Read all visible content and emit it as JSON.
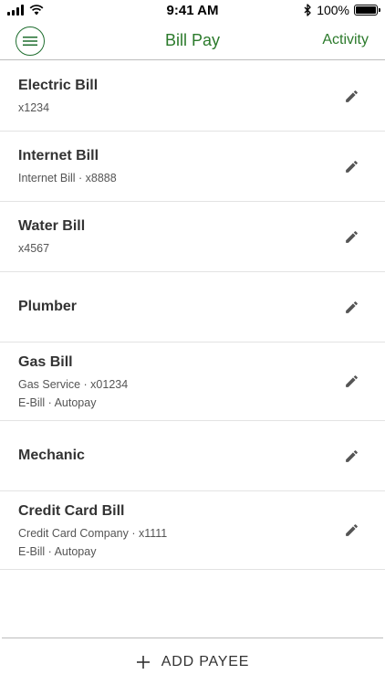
{
  "status_bar": {
    "time": "9:41 AM",
    "battery_percent": "100%",
    "battery_level": 1.0,
    "icons": [
      "cellular-signal-icon",
      "wifi-icon",
      "bluetooth-icon",
      "battery-icon"
    ]
  },
  "nav": {
    "menu_icon": "menu-icon",
    "title": "Bill Pay",
    "action_label": "Activity"
  },
  "payees": [
    {
      "name": "Electric Bill",
      "details": [
        "x1234"
      ]
    },
    {
      "name": "Internet Bill",
      "details": [
        "Internet Bill · x8888"
      ]
    },
    {
      "name": "Water Bill",
      "details": [
        "x4567"
      ]
    },
    {
      "name": "Plumber",
      "details": []
    },
    {
      "name": "Gas Bill",
      "details": [
        "Gas Service · x01234",
        "E-Bill · Autopay"
      ]
    },
    {
      "name": "Mechanic",
      "details": []
    },
    {
      "name": "Credit Card Bill",
      "details": [
        "Credit Card Company · x1111",
        "E-Bill · Autopay"
      ]
    }
  ],
  "edit_icon": "pencil-icon",
  "footer": {
    "add_icon": "plus-icon",
    "add_label": "ADD PAYEE"
  },
  "colors": {
    "accent_green": "#2b7a2b",
    "text_dark": "#333333",
    "divider": "#e3e3e3"
  }
}
